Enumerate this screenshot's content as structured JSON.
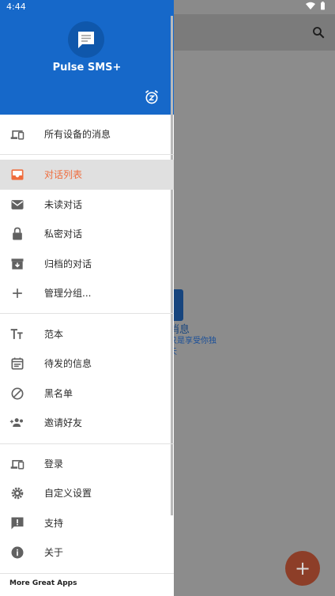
{
  "status_bar": {
    "time": "4:44"
  },
  "app": {
    "name": "Pulse SMS+",
    "accent_color": "#1668c9",
    "highlight_color": "#ef6c3d"
  },
  "drawer": {
    "sections": [
      [
        {
          "label": "所有设备的消息",
          "icon": "devices-icon"
        }
      ],
      [
        {
          "label": "对话列表",
          "icon": "inbox-icon",
          "selected": true
        },
        {
          "label": "未读对话",
          "icon": "mail-icon"
        },
        {
          "label": "私密对话",
          "icon": "lock-icon"
        },
        {
          "label": "归档的对话",
          "icon": "archive-icon"
        },
        {
          "label": "管理分组...",
          "icon": "plus-icon"
        }
      ],
      [
        {
          "label": "范本",
          "icon": "text-format-icon"
        },
        {
          "label": "待发的信息",
          "icon": "calendar-icon"
        },
        {
          "label": "黑名单",
          "icon": "block-icon"
        },
        {
          "label": "邀请好友",
          "icon": "add-people-icon"
        }
      ],
      [
        {
          "label": "登录",
          "icon": "devices-icon"
        },
        {
          "label": "自定义设置",
          "icon": "gear-icon"
        },
        {
          "label": "支持",
          "icon": "feedback-icon"
        },
        {
          "label": "关于",
          "icon": "info-icon"
        }
      ]
    ],
    "footer": "More Great Apps"
  },
  "background": {
    "empty_title": "消息",
    "empty_subtitle_1": "只是享受你独",
    "empty_subtitle_2": "天",
    "fab_label": "+"
  }
}
